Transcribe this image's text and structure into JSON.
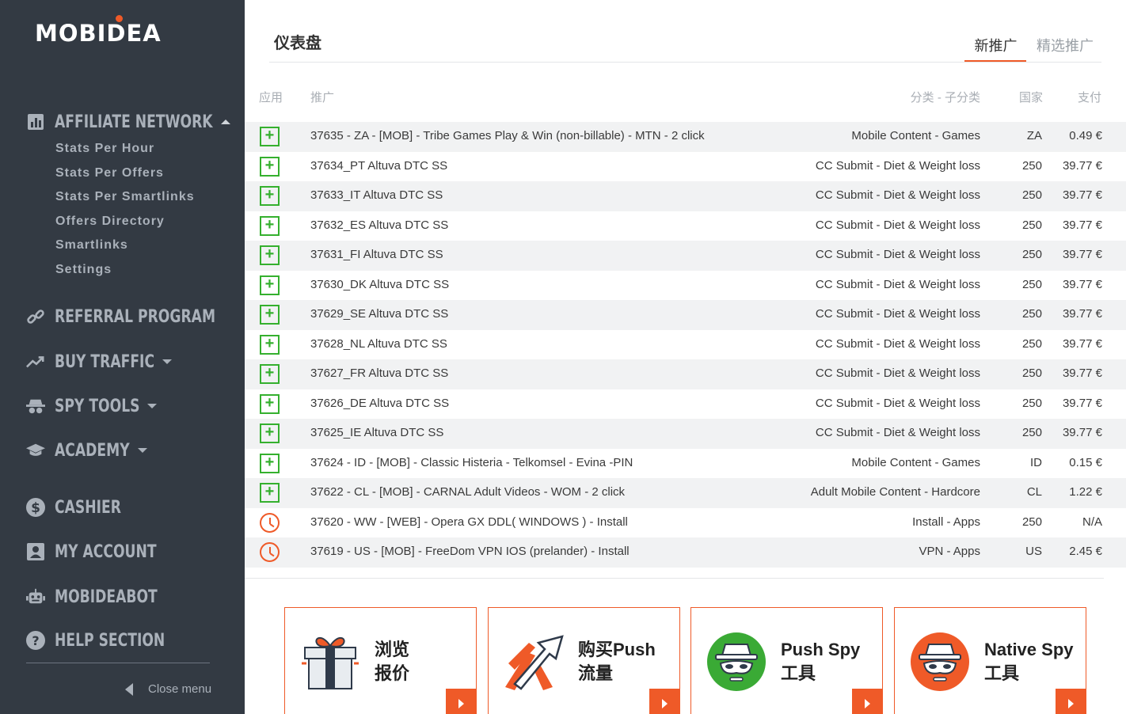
{
  "brand": {
    "logo_text": "MOBIDEA",
    "accent_color": "#ef5a28",
    "sidebar_bg": "#333a43"
  },
  "sidebar": {
    "affiliate_network": {
      "label": "AFFILIATE NETWORK",
      "icon": "bar-chart-icon",
      "items": [
        {
          "label": "Stats Per Hour"
        },
        {
          "label": "Stats Per Offers"
        },
        {
          "label": "Stats Per Smartlinks"
        },
        {
          "label": "Offers Directory"
        },
        {
          "label": "Smartlinks"
        },
        {
          "label": "Settings"
        }
      ]
    },
    "sections": [
      {
        "label": "REFERRAL PROGRAM",
        "icon": "link-icon"
      },
      {
        "label": "BUY TRAFFIC",
        "icon": "trend-up-icon"
      },
      {
        "label": "SPY TOOLS",
        "icon": "spy-icon"
      },
      {
        "label": "ACADEMY",
        "icon": "graduation-cap-icon"
      },
      {
        "label": "CASHIER",
        "icon": "dollar-icon"
      },
      {
        "label": "MY ACCOUNT",
        "icon": "user-card-icon"
      },
      {
        "label": "MOBIDEABOT",
        "icon": "robot-icon"
      },
      {
        "label": "HELP SECTION",
        "icon": "question-icon"
      }
    ],
    "close_menu": "Close menu"
  },
  "header": {
    "title": "仪表盘",
    "tabs": [
      {
        "label": "新推广",
        "active": true
      },
      {
        "label": "精选推广",
        "active": false
      }
    ]
  },
  "table": {
    "headers": {
      "app": "应用",
      "offer": "推广",
      "category": "分类 - 子分类",
      "country": "国家",
      "payout": "支付"
    },
    "rows": [
      {
        "status": "add",
        "offer": "37635 - ZA - [MOB] - Tribe Games Play & Win (non-billable) - MTN - 2 click",
        "category": "Mobile Content - Games",
        "country": "ZA",
        "payout": "0.49 €"
      },
      {
        "status": "add",
        "offer": "37634_PT Altuva DTC SS",
        "category": "CC Submit - Diet & Weight loss",
        "country": "250",
        "payout": "39.77 €"
      },
      {
        "status": "add",
        "offer": "37633_IT Altuva DTC SS",
        "category": "CC Submit - Diet & Weight loss",
        "country": "250",
        "payout": "39.77 €"
      },
      {
        "status": "add",
        "offer": "37632_ES Altuva DTC SS",
        "category": "CC Submit - Diet & Weight loss",
        "country": "250",
        "payout": "39.77 €"
      },
      {
        "status": "add",
        "offer": "37631_FI Altuva DTC SS",
        "category": "CC Submit - Diet & Weight loss",
        "country": "250",
        "payout": "39.77 €"
      },
      {
        "status": "add",
        "offer": "37630_DK Altuva DTC SS",
        "category": "CC Submit - Diet & Weight loss",
        "country": "250",
        "payout": "39.77 €"
      },
      {
        "status": "add",
        "offer": "37629_SE Altuva DTC SS",
        "category": "CC Submit - Diet & Weight loss",
        "country": "250",
        "payout": "39.77 €"
      },
      {
        "status": "add",
        "offer": "37628_NL Altuva DTC SS",
        "category": "CC Submit - Diet & Weight loss",
        "country": "250",
        "payout": "39.77 €"
      },
      {
        "status": "add",
        "offer": "37627_FR Altuva DTC SS",
        "category": "CC Submit - Diet & Weight loss",
        "country": "250",
        "payout": "39.77 €"
      },
      {
        "status": "add",
        "offer": "37626_DE Altuva DTC SS",
        "category": "CC Submit - Diet & Weight loss",
        "country": "250",
        "payout": "39.77 €"
      },
      {
        "status": "add",
        "offer": "37625_IE Altuva DTC SS",
        "category": "CC Submit - Diet & Weight loss",
        "country": "250",
        "payout": "39.77 €"
      },
      {
        "status": "add",
        "offer": "37624 - ID - [MOB] - Classic Histeria - Telkomsel - Evina -PIN",
        "category": "Mobile Content - Games",
        "country": "ID",
        "payout": "0.15 €"
      },
      {
        "status": "add",
        "offer": "37622 - CL - [MOB] - CARNAL Adult Videos - WOM - 2 click",
        "category": "Adult Mobile Content - Hardcore",
        "country": "CL",
        "payout": "1.22 €"
      },
      {
        "status": "pending",
        "offer": "37620 - WW - [WEB] - Opera GX DDL( WINDOWS ) - Install",
        "category": "Install - Apps",
        "country": "250",
        "payout": "N/A"
      },
      {
        "status": "pending",
        "offer": "37619 - US - [MOB] - FreeDom VPN IOS (prelander) - Install",
        "category": "VPN - Apps",
        "country": "US",
        "payout": "2.45 €"
      }
    ]
  },
  "cards": [
    {
      "line1": "浏览",
      "line2": "报价",
      "icon": "gift-icon"
    },
    {
      "line1": "购买Push",
      "line2": "流量",
      "icon": "arrows-up-icon"
    },
    {
      "line1": "Push Spy",
      "line2": "工具",
      "icon": "spy-green-icon"
    },
    {
      "line1": "Native Spy",
      "line2": "工具",
      "icon": "spy-orange-icon"
    }
  ]
}
